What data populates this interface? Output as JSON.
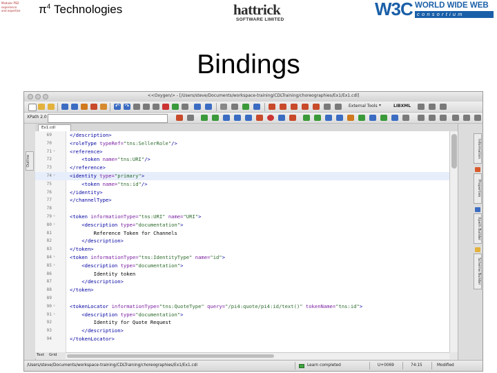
{
  "header": {
    "pi_title": "π",
    "pi_superscript": "4",
    "pi_suffix": " Technologies",
    "hattrick_name": "hattrick",
    "hattrick_sub": "SOFTWARE LIMITED",
    "w3c_mark": "W3C",
    "w3c_www": "WORLD WIDE WEB",
    "w3c_consortium": "consortium"
  },
  "slide_title": "Bindings",
  "window": {
    "title": "<<Oxygen/> - [/Users/steve/Documents/workspace-training/CDLTraining/choreographies/Ex1/Ex1.cdl]",
    "xpath_label": "XPath 2.0",
    "external_tools": "External Tools",
    "lexml": "LIBXML",
    "doc_tab": "Ex1.cdl",
    "left_tab": "Outline",
    "right_tabs": [
      "Information",
      "Properties",
      "Xpath Builder",
      "Schema Builder"
    ],
    "mode_tabs": [
      "Text",
      "Grid"
    ]
  },
  "code_lines": [
    {
      "n": "69",
      "fold": "",
      "parts": [
        [
          "t",
          "</description>"
        ]
      ]
    },
    {
      "n": "70",
      "fold": "",
      "parts": [
        [
          "t",
          "<roleType "
        ],
        [
          "a",
          "typeRef="
        ],
        [
          "v",
          "\"tns:SellerRole\""
        ],
        [
          "t",
          "/>"
        ]
      ]
    },
    {
      "n": "71",
      "fold": "▿",
      "parts": [
        [
          "t",
          "<reference>"
        ]
      ]
    },
    {
      "n": "72",
      "fold": "",
      "parts": [
        [
          "t",
          "    <token "
        ],
        [
          "a",
          "name="
        ],
        [
          "v",
          "\"tns:URI\""
        ],
        [
          "t",
          "/>"
        ]
      ]
    },
    {
      "n": "73",
      "fold": "",
      "parts": [
        [
          "t",
          "</reference>"
        ]
      ]
    },
    {
      "n": "74",
      "fold": "▿",
      "hl": true,
      "parts": [
        [
          "t",
          "<identity "
        ],
        [
          "a",
          "type="
        ],
        [
          "v",
          "\"primary\""
        ],
        [
          "t",
          ">"
        ]
      ]
    },
    {
      "n": "75",
      "fold": "",
      "parts": [
        [
          "t",
          "    <token "
        ],
        [
          "a",
          "name="
        ],
        [
          "v",
          "\"tns:id\""
        ],
        [
          "t",
          "/>"
        ]
      ]
    },
    {
      "n": "76",
      "fold": "",
      "parts": [
        [
          "t",
          "</identity>"
        ]
      ]
    },
    {
      "n": "77",
      "fold": "",
      "parts": [
        [
          "t",
          "</channelType>"
        ]
      ]
    },
    {
      "n": "78",
      "fold": "",
      "parts": []
    },
    {
      "n": "79",
      "fold": "▿",
      "parts": [
        [
          "t",
          "<token "
        ],
        [
          "a",
          "informationType="
        ],
        [
          "v",
          "\"tns:URI\" "
        ],
        [
          "a",
          "name="
        ],
        [
          "v",
          "\"URI\""
        ],
        [
          "t",
          ">"
        ]
      ]
    },
    {
      "n": "80",
      "fold": "▿",
      "parts": [
        [
          "t",
          "    <description "
        ],
        [
          "a",
          "type="
        ],
        [
          "v",
          "\"documentation\""
        ],
        [
          "t",
          ">"
        ]
      ]
    },
    {
      "n": "81",
      "fold": "",
      "parts": [
        [
          "p",
          "        Reference Token for Channels"
        ]
      ]
    },
    {
      "n": "82",
      "fold": "",
      "parts": [
        [
          "t",
          "    </description>"
        ]
      ]
    },
    {
      "n": "83",
      "fold": "",
      "parts": [
        [
          "t",
          "</token>"
        ]
      ]
    },
    {
      "n": "84",
      "fold": "▿",
      "parts": [
        [
          "t",
          "<token "
        ],
        [
          "a",
          "informationType="
        ],
        [
          "v",
          "\"tns:IdentityType\" "
        ],
        [
          "a",
          "name="
        ],
        [
          "v",
          "\"id\""
        ],
        [
          "t",
          ">"
        ]
      ]
    },
    {
      "n": "85",
      "fold": "▿",
      "parts": [
        [
          "t",
          "    <description "
        ],
        [
          "a",
          "type="
        ],
        [
          "v",
          "\"documentation\""
        ],
        [
          "t",
          ">"
        ]
      ]
    },
    {
      "n": "86",
      "fold": "",
      "parts": [
        [
          "p",
          "        Identity token"
        ]
      ]
    },
    {
      "n": "87",
      "fold": "",
      "parts": [
        [
          "t",
          "    </description>"
        ]
      ]
    },
    {
      "n": "88",
      "fold": "",
      "parts": [
        [
          "t",
          "</token>"
        ]
      ]
    },
    {
      "n": "89",
      "fold": "",
      "parts": []
    },
    {
      "n": "90",
      "fold": "▿",
      "parts": [
        [
          "t",
          "<tokenLocator "
        ],
        [
          "a",
          "informationType="
        ],
        [
          "v",
          "\"tns:QuoteType\" "
        ],
        [
          "a",
          "query="
        ],
        [
          "v",
          "\"/pi4:quote/pi4:id/text()\" "
        ],
        [
          "a",
          "tokenName="
        ],
        [
          "v",
          "\"tns:id\""
        ],
        [
          "t",
          ">"
        ]
      ]
    },
    {
      "n": "91",
      "fold": "▿",
      "parts": [
        [
          "t",
          "    <description "
        ],
        [
          "a",
          "type="
        ],
        [
          "v",
          "\"documentation\""
        ],
        [
          "t",
          ">"
        ]
      ]
    },
    {
      "n": "92",
      "fold": "",
      "parts": [
        [
          "p",
          "        Identity for Quote Request"
        ]
      ]
    },
    {
      "n": "93",
      "fold": "",
      "parts": [
        [
          "t",
          "    </description>"
        ]
      ]
    },
    {
      "n": "94",
      "fold": "",
      "parts": [
        [
          "t",
          "</tokenLocator>"
        ]
      ]
    }
  ],
  "statusbar": {
    "path": "/Users/steve/Documents/workspace-training/CDLTraining/choreographies/Ex1/Ex1.cdl",
    "learn": "Learn completed",
    "unicode": "U+0069",
    "position": "74:15",
    "modified": "Modified"
  },
  "colors": {
    "tag": "#0000a0",
    "attribute": "#7a1fa0",
    "value": "#2b6a2b",
    "w3c_blue": "#1a5fa8"
  }
}
